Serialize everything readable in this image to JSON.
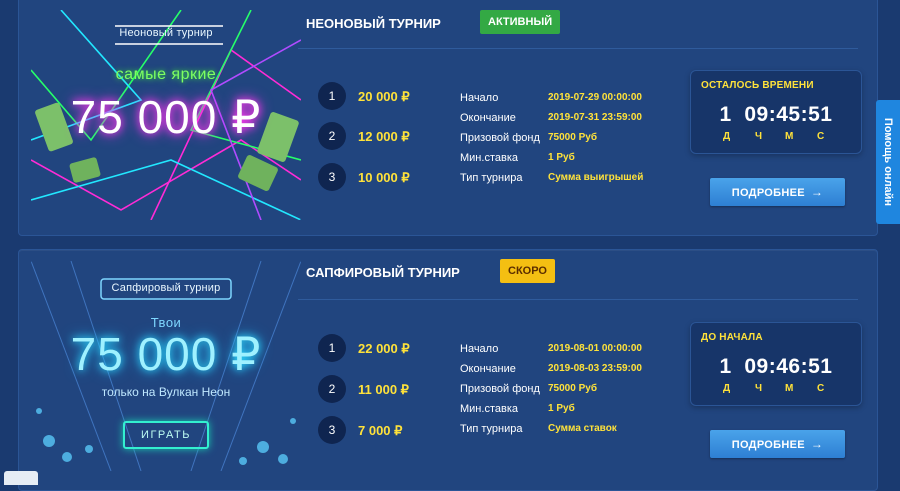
{
  "tournaments": [
    {
      "title": "НЕОНОВЫЙ ТУРНИР",
      "status": "АКТИВНЫЙ",
      "banner": {
        "name": "Неоновый турнир",
        "subtitle": "самые яркие",
        "amount": "75 000 ₽"
      },
      "prizes": [
        {
          "rank": "1",
          "amount": "20 000 ₽"
        },
        {
          "rank": "2",
          "amount": "12 000 ₽"
        },
        {
          "rank": "3",
          "amount": "10 000 ₽"
        }
      ],
      "info": [
        {
          "label": "Начало",
          "value": "2019-07-29 00:00:00"
        },
        {
          "label": "Окончание",
          "value": "2019-07-31 23:59:00"
        },
        {
          "label": "Призовой фонд",
          "value": "75000 Руб"
        },
        {
          "label": "Мин.ставка",
          "value": "1 Руб"
        },
        {
          "label": "Тип турнира",
          "value": "Сумма выигрышей"
        }
      ],
      "timer": {
        "label": "ОСТАЛОСЬ ВРЕМЕНИ",
        "value": "1  09:45:51",
        "units": [
          "Д",
          "Ч",
          "М",
          "С"
        ]
      },
      "more_label": "ПОДРОБНЕЕ"
    },
    {
      "title": "САПФИРОВЫЙ ТУРНИР",
      "status": "СКОРО",
      "banner": {
        "name": "Сапфировый турнир",
        "subtitle": "Твои",
        "amount": "75 000 ₽",
        "note": "только на Вулкан Неон",
        "button": "ИГРАТЬ"
      },
      "prizes": [
        {
          "rank": "1",
          "amount": "22 000 ₽"
        },
        {
          "rank": "2",
          "amount": "11 000 ₽"
        },
        {
          "rank": "3",
          "amount": "7 000 ₽"
        }
      ],
      "info": [
        {
          "label": "Начало",
          "value": "2019-08-01 00:00:00"
        },
        {
          "label": "Окончание",
          "value": "2019-08-03 23:59:00"
        },
        {
          "label": "Призовой фонд",
          "value": "75000 Руб"
        },
        {
          "label": "Мин.ставка",
          "value": "1 Руб"
        },
        {
          "label": "Тип турнира",
          "value": "Сумма ставок"
        }
      ],
      "timer": {
        "label": "ДО НАЧАЛА",
        "value": "1  09:46:51",
        "units": [
          "Д",
          "Ч",
          "М",
          "С"
        ]
      },
      "more_label": "ПОДРОБНЕЕ"
    }
  ],
  "help_tab": "Помощь онлайн",
  "colors": {
    "accent_yellow": "#ffe23a",
    "active_green": "#33a944",
    "soon_orange": "#f4bf12",
    "button_blue": "#2e7fd3",
    "card_bg": "#21457f"
  }
}
